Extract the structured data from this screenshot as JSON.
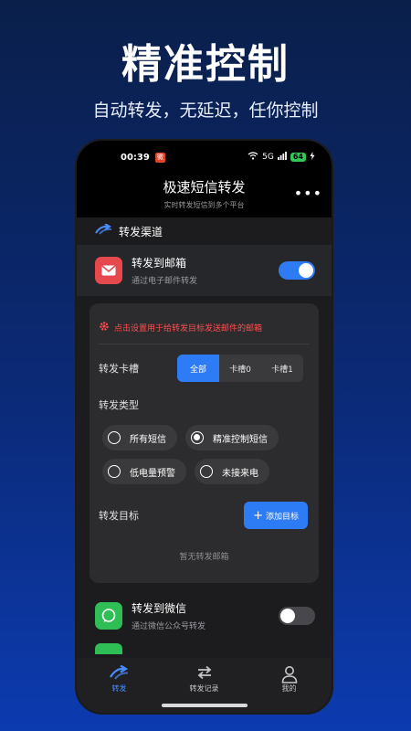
{
  "promo": {
    "title": "精准控制",
    "subtitle": "自动转发，无延迟，任你控制"
  },
  "status_bar": {
    "time": "00:39",
    "badge": "微",
    "network": "5G",
    "battery": "64"
  },
  "header": {
    "title": "极速短信转发",
    "subtitle": "实时转发短信到多个平台",
    "more": "•••"
  },
  "section": {
    "title": "转发渠道"
  },
  "email_channel": {
    "title": "转发到邮箱",
    "desc": "通过电子邮件转发",
    "enabled": true
  },
  "email_settings": {
    "hint": "点击设置用于给转发目标发送邮件的邮箱",
    "slot_label": "转发卡槽",
    "slots": [
      "全部",
      "卡槽0",
      "卡槽1"
    ],
    "selected_slot": "全部",
    "type_label": "转发类型",
    "types": [
      {
        "label": "所有短信",
        "checked": false
      },
      {
        "label": "精准控制短信",
        "checked": true
      },
      {
        "label": "低电量预警",
        "checked": false
      },
      {
        "label": "未接来电",
        "checked": false
      }
    ],
    "target_label": "转发目标",
    "add_target": "添加目标",
    "empty": "暂无转发邮箱"
  },
  "wechat_channel": {
    "title": "转发到微信",
    "desc": "通过微信公众号转发",
    "enabled": false
  },
  "tabbar": {
    "tabs": [
      {
        "label": "转发",
        "icon": "forward-icon",
        "active": true
      },
      {
        "label": "转发记录",
        "icon": "swap-icon",
        "active": false
      },
      {
        "label": "我的",
        "icon": "user-icon",
        "active": false
      }
    ]
  },
  "colors": {
    "accent": "#2d7cf6",
    "danger": "#ff4d4f",
    "mail_icon": "#e5484d",
    "wechat_icon": "#2fbe55"
  }
}
